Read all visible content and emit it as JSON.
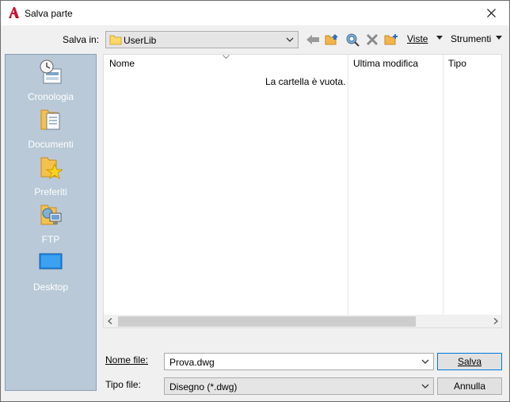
{
  "window": {
    "title": "Salva parte"
  },
  "toolbar": {
    "save_in_label": "Salva in:",
    "save_in_value": "UserLib",
    "views_label": "Viste",
    "tools_label": "Strumenti"
  },
  "places": [
    {
      "label": "Cronologia",
      "icon": "history-icon"
    },
    {
      "label": "Documenti",
      "icon": "documents-icon"
    },
    {
      "label": "Preferiti",
      "icon": "favorites-icon"
    },
    {
      "label": "FTP",
      "icon": "ftp-icon"
    },
    {
      "label": "Desktop",
      "icon": "desktop-icon"
    }
  ],
  "filelist": {
    "columns": [
      "Nome",
      "Ultima modifica",
      "Tipo"
    ],
    "empty_message": "La cartella è vuota."
  },
  "form": {
    "filename_label": "Nome file:",
    "filename_value": "Prova.dwg",
    "filetype_label": "Tipo file:",
    "filetype_value": "Disegno (*.dwg)",
    "save_button": "Salva",
    "cancel_button": "Annulla"
  },
  "colors": {
    "places_bg": "#b9c9d8",
    "accent": "#0078d7",
    "app_icon": "#c8102e"
  }
}
